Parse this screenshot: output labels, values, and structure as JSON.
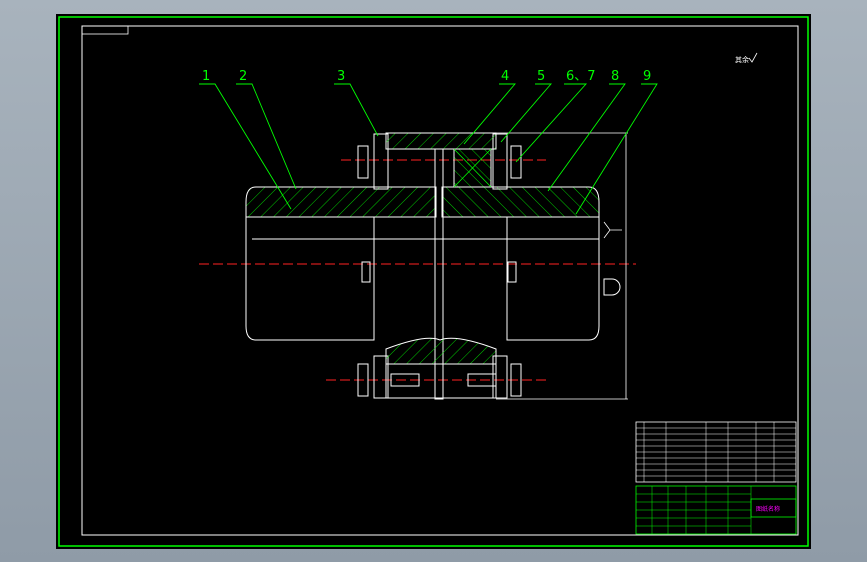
{
  "colors": {
    "background": "#000000",
    "frame": "#00ff00",
    "outline": "#ffffff",
    "hatch": "#00ff00",
    "centerline": "#ff2222",
    "title_block_accent": "#ff00ff"
  },
  "drawing": {
    "part_labels": [
      "1",
      "2",
      "3",
      "4",
      "5",
      "6、7",
      "8",
      "9"
    ],
    "roughness_note": "其余",
    "dimension_note": "D"
  },
  "title_block": {
    "drawing_title": "图纸名称",
    "bom_rows": 10,
    "approval_cells": [
      "设计",
      "校核",
      "审核",
      "工艺",
      "标准化",
      "批准"
    ]
  }
}
